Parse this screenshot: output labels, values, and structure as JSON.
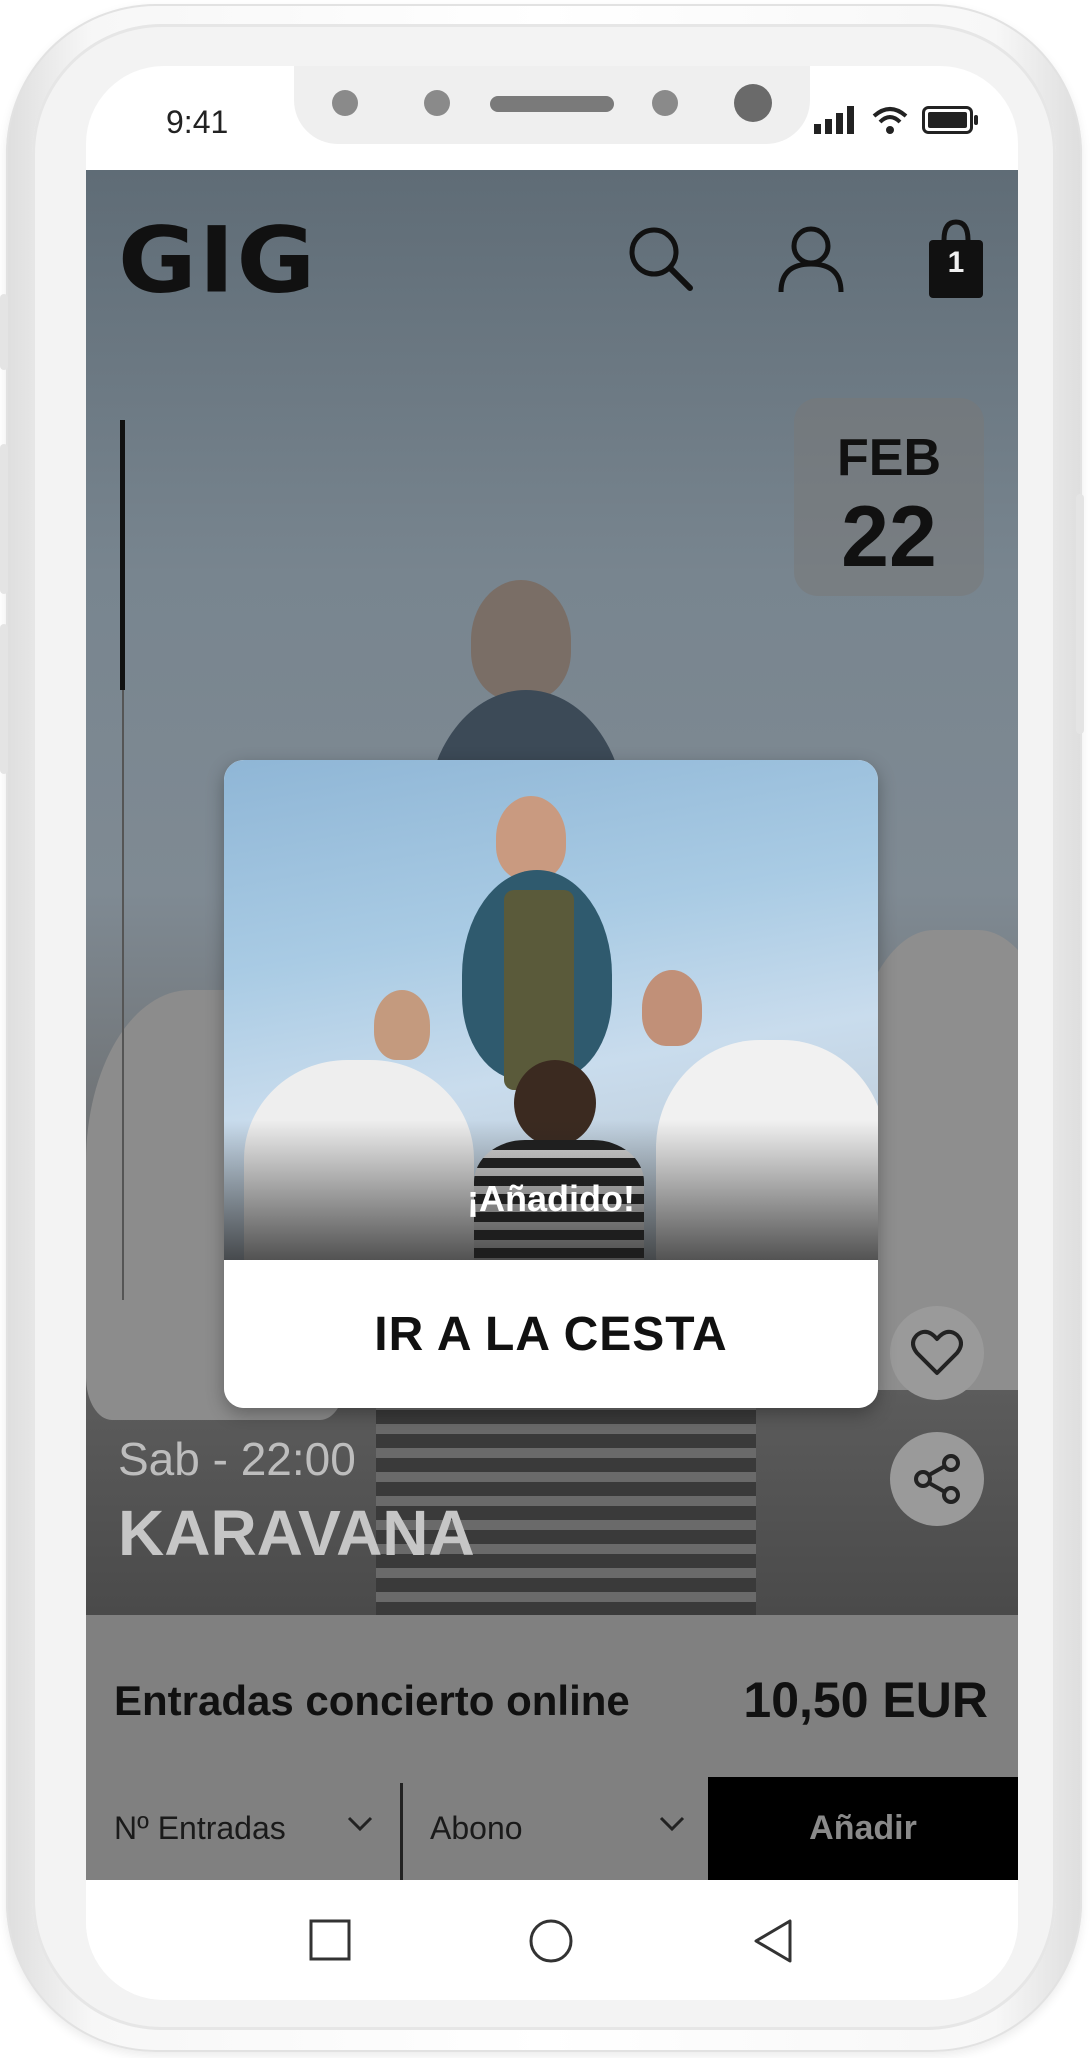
{
  "status_bar": {
    "time": "9:41"
  },
  "header": {
    "logo": "GIG",
    "cart_count": "1"
  },
  "event": {
    "month": "FEB",
    "day": "22",
    "time": "Sab - 22:00",
    "name": "KARAVANA"
  },
  "modal": {
    "status": "¡Añadido!",
    "cta_label": "IR A LA CESTA"
  },
  "tickets": {
    "title": "Entradas concierto online",
    "price": "10,50 EUR",
    "quantity_label": "Nº Entradas",
    "type_label": "Abono",
    "add_label": "Añadir"
  },
  "icons": {
    "search": "search-icon",
    "account": "user-icon",
    "cart": "shopping-bag-icon",
    "favorite": "heart-icon",
    "share": "share-icon",
    "chevron": "chevron-down-icon",
    "nav_recents": "square-icon",
    "nav_home": "circle-icon",
    "nav_back": "triangle-back-icon"
  },
  "colors": {
    "overlay_gray": "#808080",
    "button_black": "#000000",
    "modal_white": "#ffffff"
  }
}
